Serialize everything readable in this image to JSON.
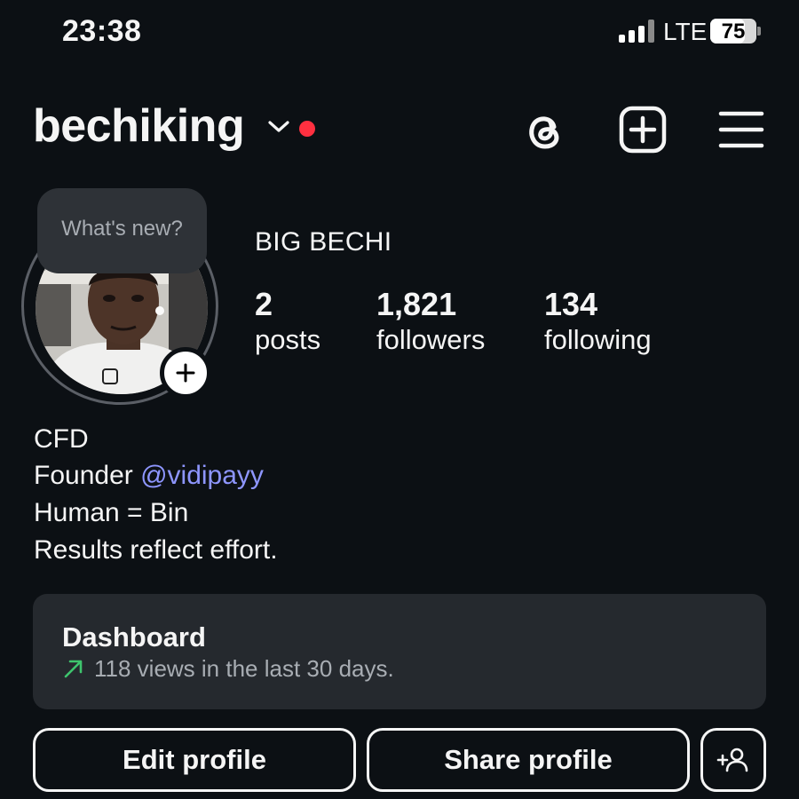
{
  "status_bar": {
    "time": "23:38",
    "network": "LTE",
    "battery": "75",
    "battery_level": 0.75,
    "signal_icon": "cellular-signal-icon"
  },
  "header": {
    "username": "bechiking",
    "notification_dot_color": "#ff3040",
    "icons": [
      "threads-icon",
      "create-post-icon",
      "menu-icon"
    ]
  },
  "avatar": {
    "bubble_text": "What's new?",
    "add_story_icon": "plus-icon"
  },
  "profile": {
    "display_name": "BIG BECHI",
    "stats": [
      {
        "value": "2",
        "label": "posts"
      },
      {
        "value": "1,821",
        "label": "followers"
      },
      {
        "value": "134",
        "label": "following"
      }
    ]
  },
  "bio": {
    "line1": "CFD",
    "line2_prefix": "Founder ",
    "line2_mention": "@vidipayy",
    "line3": "Human = Bin",
    "line4": "Results reflect effort."
  },
  "dashboard": {
    "title": "Dashboard",
    "subtitle": "118 views in the last 30 days.",
    "trend_icon": "trending-up-arrow-icon",
    "trend_color": "#3ec46d"
  },
  "actions": {
    "edit_profile": "Edit profile",
    "share_profile": "Share profile",
    "discover_people_icon": "add-person-icon"
  },
  "colors": {
    "background": "#0c1014",
    "card": "#25292e",
    "mention": "#8e96ff"
  }
}
